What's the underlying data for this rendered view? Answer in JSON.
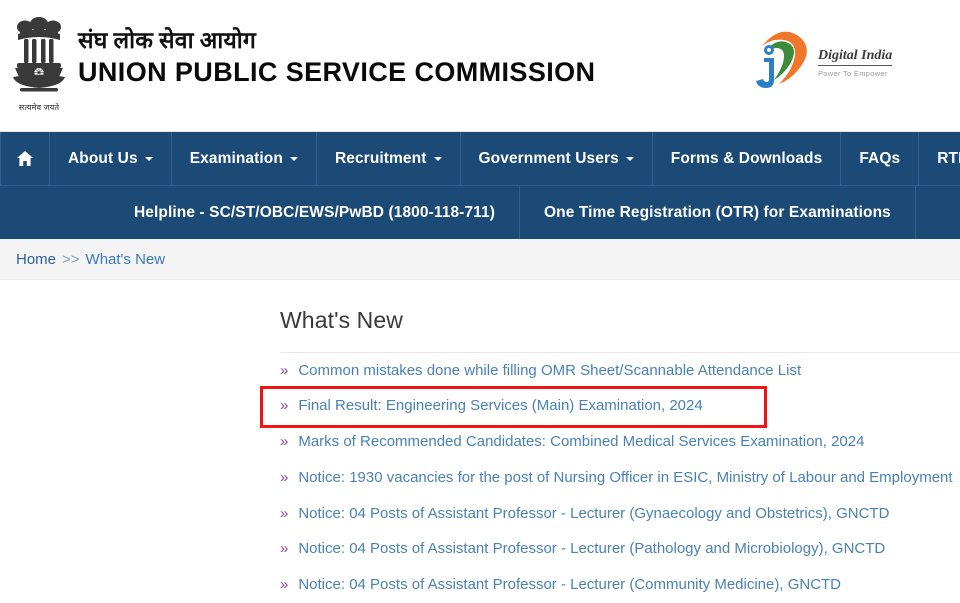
{
  "header": {
    "emblem_name": "national-emblem-of-india",
    "emblem_motto": "सत्यमेव जयते",
    "title_hindi": "संघ लोक सेवा आयोग",
    "title_english": "UNION PUBLIC SERVICE COMMISSION",
    "digital_india": {
      "name": "Digital India",
      "tagline": "Power To Empower"
    }
  },
  "nav": {
    "row1": [
      {
        "label": "",
        "icon": "home-icon",
        "caret": false
      },
      {
        "label": "About Us",
        "caret": true
      },
      {
        "label": "Examination",
        "caret": true
      },
      {
        "label": "Recruitment",
        "caret": true
      },
      {
        "label": "Government Users",
        "caret": true
      },
      {
        "label": "Forms & Downloads",
        "caret": false
      },
      {
        "label": "FAQs",
        "caret": false
      },
      {
        "label": "RTI",
        "caret": false
      }
    ],
    "row2": [
      {
        "label": "Helpline - SC/ST/OBC/EWS/PwBD (1800-118-711)"
      },
      {
        "label": "One Time Registration (OTR) for Examinations"
      }
    ]
  },
  "breadcrumb": {
    "home": "Home",
    "separator": ">>",
    "current": "What's New"
  },
  "main": {
    "page_title": "What's New",
    "bullet_glyph": "»",
    "items": [
      {
        "text": "Common mistakes done while filling OMR Sheet/Scannable Attendance List",
        "highlighted": false
      },
      {
        "text": "Final Result: Engineering Services (Main) Examination, 2024",
        "highlighted": true
      },
      {
        "text": "Marks of Recommended Candidates: Combined Medical Services Examination, 2024",
        "highlighted": false
      },
      {
        "text": "Notice: 1930 vacancies for the post of Nursing Officer in ESIC, Ministry of Labour and Employment",
        "highlighted": false
      },
      {
        "text": "Notice: 04 Posts of Assistant Professor - Lecturer (Gynaecology and Obstetrics), GNCTD",
        "highlighted": false
      },
      {
        "text": "Notice: 04 Posts of Assistant Professor - Lecturer (Pathology and Microbiology), GNCTD",
        "highlighted": false
      },
      {
        "text": "Notice: 04 Posts of Assistant Professor - Lecturer (Community Medicine), GNCTD",
        "highlighted": false
      }
    ]
  },
  "colors": {
    "nav_background": "#1b4a77",
    "link_blue": "#4a81b4",
    "bullet_purple": "#8a4a8a",
    "highlight_red": "#f01414",
    "breadcrumb_background": "#f4f4f4",
    "saffron": "#f07d28",
    "green": "#3c8c3c"
  }
}
